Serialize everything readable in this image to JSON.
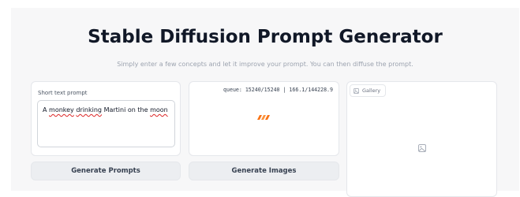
{
  "header": {
    "title": "Stable Diffusion Prompt Generator",
    "subtitle": "Simply enter a few concepts and let it improve your prompt. You can then diffuse the prompt."
  },
  "prompt_panel": {
    "label": "Short text prompt",
    "value_words": [
      "A",
      "monkey",
      "drinking",
      "Martini",
      "on",
      "the",
      "moon"
    ]
  },
  "status_panel": {
    "queue_text": "queue: 15240/15240 | 166.1/144228.9",
    "loader_color": "#f97316"
  },
  "gallery_panel": {
    "tab_label": "Gallery",
    "tab_icon": "image-icon",
    "placeholder_icon": "image-icon"
  },
  "buttons": {
    "generate_prompts": "Generate Prompts",
    "generate_images": "Generate Images"
  }
}
